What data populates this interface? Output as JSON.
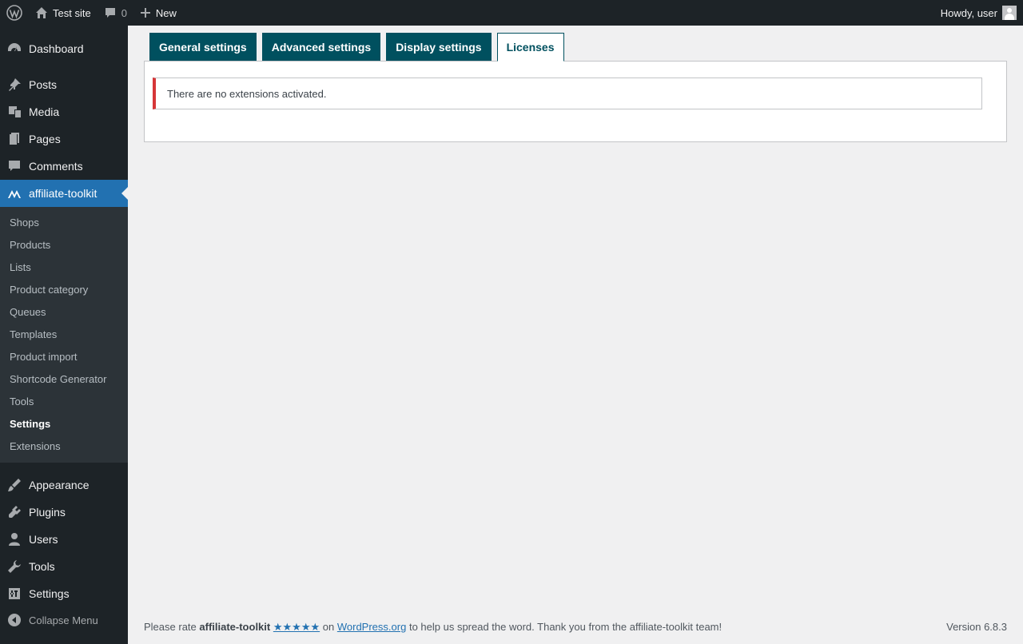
{
  "adminbar": {
    "site_name": "Test site",
    "comments_count": "0",
    "new_label": "New",
    "howdy": "Howdy, user"
  },
  "menu": {
    "dashboard": "Dashboard",
    "posts": "Posts",
    "media": "Media",
    "pages": "Pages",
    "comments": "Comments",
    "affiliate_toolkit": "affiliate-toolkit",
    "appearance": "Appearance",
    "plugins": "Plugins",
    "users": "Users",
    "tools": "Tools",
    "settings": "Settings",
    "collapse": "Collapse Menu"
  },
  "submenu": [
    "Shops",
    "Products",
    "Lists",
    "Product category",
    "Queues",
    "Templates",
    "Product import",
    "Shortcode Generator",
    "Tools",
    "Settings",
    "Extensions"
  ],
  "tabs": [
    "General settings",
    "Advanced settings",
    "Display settings",
    "Licenses"
  ],
  "notice": "There are no extensions activated.",
  "footer": {
    "prefix": "Please rate",
    "plugin_name": "affiliate-toolkit",
    "stars": "★★★★★",
    "on": "on",
    "link": "WordPress.org",
    "suffix": "to help us spread the word. Thank you from the affiliate-toolkit team!",
    "version": "Version 6.8.3"
  },
  "colors": {
    "adminbar": "#1d2327",
    "accent": "#2271b1",
    "tab": "#00505f",
    "notice_error": "#d63638"
  }
}
